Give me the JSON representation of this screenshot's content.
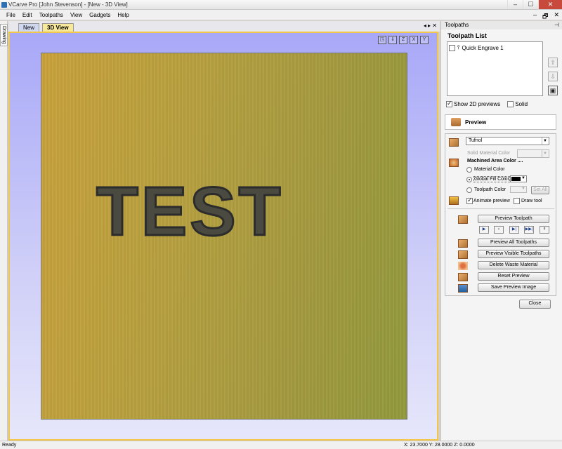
{
  "window": {
    "title": "VCarve Pro [John Stevenson] - [New - 3D View]",
    "min": "–",
    "max": "☐",
    "close": "✕"
  },
  "menu": [
    "File",
    "Edit",
    "Toolpaths",
    "View",
    "Gadgets",
    "Help"
  ],
  "mdi_controls": [
    "–",
    "🗗",
    "✕"
  ],
  "left_tab": "Drawing",
  "doc_tabs": {
    "new": "New",
    "view3d": "3D View",
    "controls": "◂ ▸ ✕"
  },
  "view_toolbar": [
    "◳",
    "⇓",
    "Z",
    "X",
    "Y"
  ],
  "view_toolbar_icons": [
    "zoom-extents-icon",
    "iso-view-icon",
    "top-view-icon",
    "x-view-icon",
    "y-view-icon"
  ],
  "engrave_text": "TEST",
  "panel": {
    "title": "Toolpaths",
    "pin": "⊣",
    "list_title": "Toolpath List",
    "toolpaths": [
      {
        "name": "Quick Engrave 1",
        "checked": false
      }
    ],
    "show_previews": "Show 2D previews",
    "show_previews_checked": true,
    "solid": "Solid",
    "solid_checked": false,
    "side_buttons": [
      "⇧",
      "⇩",
      "▣"
    ]
  },
  "preview": {
    "header": "Preview",
    "material": "Tufnol",
    "solid_material_color": "Solid Material Color",
    "machined_area_color": "Machined Area Color ....",
    "material_color": "Material Color",
    "global_fill_color": "Global Fill Color",
    "toolpath_color": "Toolpath Color",
    "set_all": "Set All",
    "animate_preview": "Animate preview",
    "animate_checked": true,
    "draw_tool": "Draw tool",
    "draw_checked": false,
    "preview_toolpath": "Preview Toolpath",
    "play_controls": [
      "▶",
      "⏸",
      "▶|",
      "▶▶|",
      "⇞"
    ],
    "preview_all": "Preview All Toolpaths",
    "preview_visible": "Preview Visible Toolpaths",
    "delete_waste": "Delete Waste Material",
    "reset_preview": "Reset Preview",
    "save_preview": "Save Preview Image",
    "close": "Close"
  },
  "colors": {
    "accent": "#f2c84c",
    "fill": "#000000"
  },
  "status": {
    "left": "Ready",
    "coords": "X: 23.7000 Y: 28.0000  Z:  0.0000"
  }
}
